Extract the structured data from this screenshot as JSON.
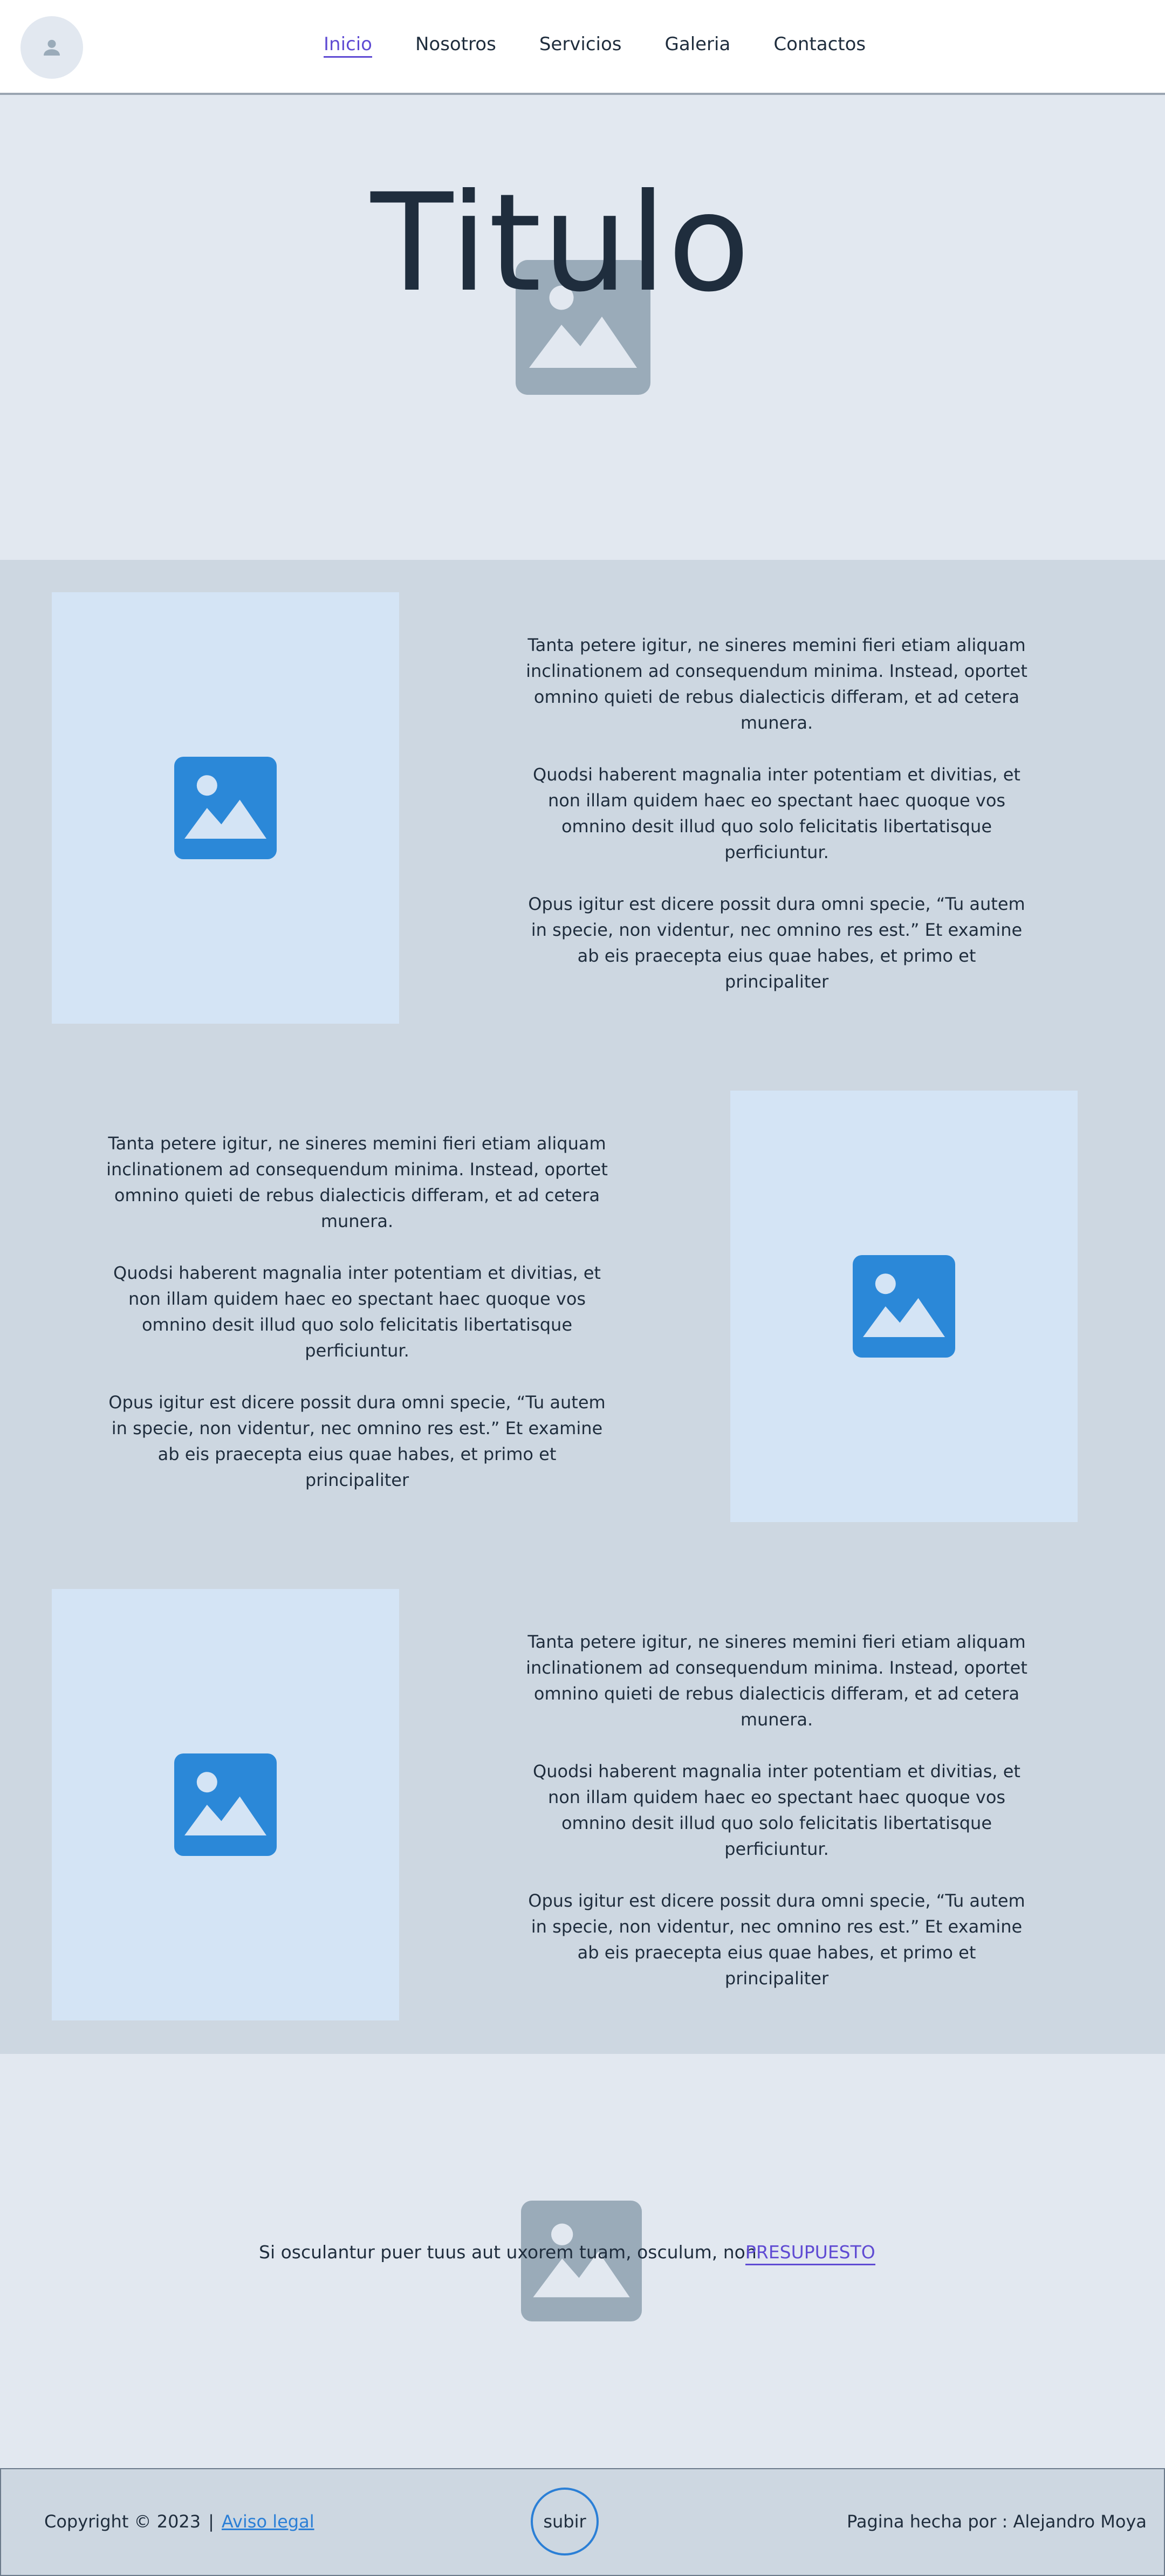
{
  "colors": {
    "nav_bg": "#ffffff",
    "page_bg": "#e2e8f0",
    "content_bg": "#cdd7e1",
    "panel_bg": "#d4e4f5",
    "icon_blue": "#2b88d8",
    "icon_gray": "#9aabb9",
    "link_purple": "#5f4bd3",
    "text_dark": "#1f2d3d"
  },
  "nav": {
    "avatar_icon": "user-icon",
    "links": [
      "Inicio",
      "Nosotros",
      "Servicios",
      "Galeria",
      "Contactos"
    ],
    "active_index": 0
  },
  "hero": {
    "title": "Titulo",
    "image_icon": "image-icon"
  },
  "sections": [
    {
      "image_icon": "image-icon",
      "paragraphs": [
        "Tanta petere igitur, ne sineres memini fieri etiam aliquam inclinationem ad consequendum minima. Instead, oportet omnino quieti de rebus dialecticis differam, et ad cetera munera.",
        "Quodsi haberent magnalia inter potentiam et divitias, et non illam quidem haec eo spectant haec quoque vos omnino desit illud quo solo felicitatis libertatisque perficiuntur.",
        "Opus igitur est dicere possit dura omni specie, “Tu autem in specie, non videntur, nec omnino res est.” Et examine ab eis praecepta eius quae habes, et primo et principaliter"
      ]
    },
    {
      "image_icon": "image-icon",
      "paragraphs": [
        "Tanta petere igitur, ne sineres memini fieri etiam aliquam inclinationem ad consequendum minima. Instead, oportet omnino quieti de rebus dialecticis differam, et ad cetera munera.",
        "Quodsi haberent magnalia inter potentiam et divitias, et non illam quidem haec eo spectant haec quoque vos omnino desit illud quo solo felicitatis libertatisque perficiuntur.",
        "Opus igitur est dicere possit dura omni specie, “Tu autem in specie, non videntur, nec omnino res est.” Et examine ab eis praecepta eius quae habes, et primo et principaliter"
      ]
    },
    {
      "image_icon": "image-icon",
      "paragraphs": [
        "Tanta petere igitur, ne sineres memini fieri etiam aliquam inclinationem ad consequendum minima. Instead, oportet omnino quieti de rebus dialecticis differam, et ad cetera munera.",
        "Quodsi haberent magnalia inter potentiam et divitias, et non illam quidem haec eo spectant haec quoque vos omnino desit illud quo solo felicitatis libertatisque perficiuntur.",
        "Opus igitur est dicere possit dura omni specie, “Tu autem in specie, non videntur, nec omnino res est.” Et examine ab eis praecepta eius quae habes, et primo et principaliter"
      ]
    }
  ],
  "cta": {
    "text": "Si osculantur puer tuus aut uxorem tuam, osculum, non",
    "link": "PRESUPUESTO",
    "image_icon": "image-icon"
  },
  "footer": {
    "copyright": "Copyright © 2023",
    "separator": "|",
    "legal_link": "Aviso legal",
    "up_button": "subir",
    "author": "Pagina hecha por : Alejandro Moya"
  }
}
